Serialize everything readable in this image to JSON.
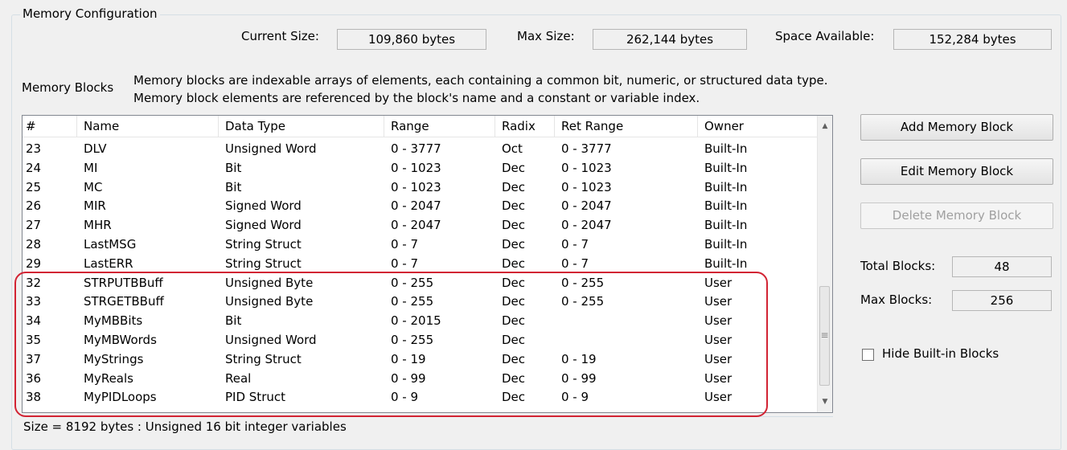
{
  "group": {
    "title": "Memory Configuration"
  },
  "sizes": {
    "current_label": "Current Size:",
    "current_value": "109,860 bytes",
    "max_label": "Max Size:",
    "max_value": "262,144 bytes",
    "avail_label": "Space Available:",
    "avail_value": "152,284 bytes"
  },
  "memory_blocks": {
    "label": "Memory Blocks",
    "description": "Memory blocks are indexable arrays of elements, each containing a common bit, numeric, or structured data type. Memory block elements are referenced by the block's name and a constant or variable index."
  },
  "table": {
    "headers": [
      "#",
      "Name",
      "Data Type",
      "Range",
      "Radix",
      "Ret Range",
      "Owner"
    ],
    "rows": [
      [
        "23",
        "DLV",
        "Unsigned Word",
        "0 - 3777",
        "Oct",
        "0 - 3777",
        "Built-In"
      ],
      [
        "24",
        "MI",
        "Bit",
        "0 - 1023",
        "Dec",
        "0 - 1023",
        "Built-In"
      ],
      [
        "25",
        "MC",
        "Bit",
        "0 - 1023",
        "Dec",
        "0 - 1023",
        "Built-In"
      ],
      [
        "26",
        "MIR",
        "Signed Word",
        "0 - 2047",
        "Dec",
        "0 - 2047",
        "Built-In"
      ],
      [
        "27",
        "MHR",
        "Signed Word",
        "0 - 2047",
        "Dec",
        "0 - 2047",
        "Built-In"
      ],
      [
        "28",
        "LastMSG",
        "String Struct",
        "0 - 7",
        "Dec",
        "0 - 7",
        "Built-In"
      ],
      [
        "29",
        "LastERR",
        "String Struct",
        "0 - 7",
        "Dec",
        "0 - 7",
        "Built-In"
      ],
      [
        "32",
        "STRPUTBBuff",
        "Unsigned Byte",
        "0 - 255",
        "Dec",
        "0 - 255",
        "User"
      ],
      [
        "33",
        "STRGETBBuff",
        "Unsigned Byte",
        "0 - 255",
        "Dec",
        "0 - 255",
        "User"
      ],
      [
        "34",
        "MyMBBits",
        "Bit",
        "0 - 2015",
        "Dec",
        "",
        "User"
      ],
      [
        "35",
        "MyMBWords",
        "Unsigned Word",
        "0 - 255",
        "Dec",
        "",
        "User"
      ],
      [
        "37",
        "MyStrings",
        "String Struct",
        "0 - 19",
        "Dec",
        "0 - 19",
        "User"
      ],
      [
        "36",
        "MyReals",
        "Real",
        "0 - 99",
        "Dec",
        "0 - 99",
        "User"
      ],
      [
        "38",
        "MyPIDLoops",
        "PID Struct",
        "0 - 9",
        "Dec",
        "0 - 9",
        "User"
      ]
    ]
  },
  "buttons": {
    "add": "Add Memory Block",
    "edit": "Edit Memory Block",
    "delete": "Delete Memory Block"
  },
  "totals": {
    "total_label": "Total Blocks:",
    "total_value": "48",
    "max_label": "Max Blocks:",
    "max_value": "256"
  },
  "hide_builtin": {
    "label": "Hide Built-in Blocks",
    "checked": false
  },
  "status": {
    "text": "Size = 8192 bytes : Unsigned 16 bit integer variables"
  },
  "colors": {
    "highlight": "#d22333",
    "window_bg": "#f0f0f0"
  },
  "scrollbar": {
    "up_icon": "▲",
    "down_icon": "▼",
    "grip_icon": "≡"
  }
}
